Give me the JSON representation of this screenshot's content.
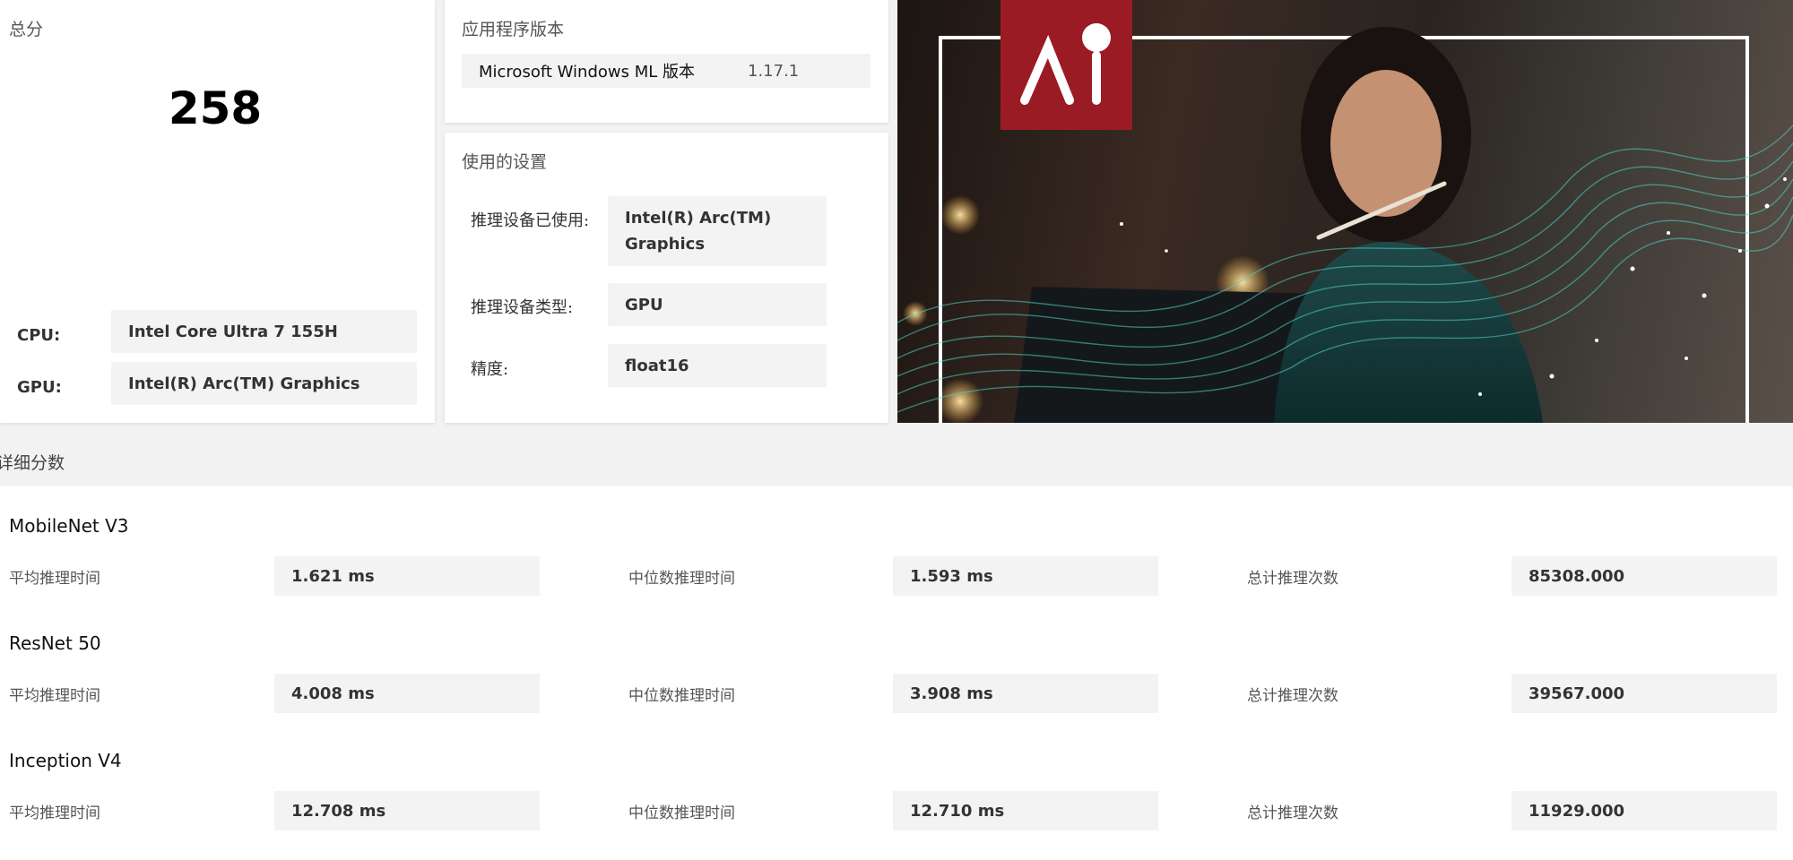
{
  "score": {
    "title": "总分",
    "value": "258",
    "cpu_label": "CPU:",
    "cpu_value": "Intel Core Ultra 7 155H",
    "gpu_label": "GPU:",
    "gpu_value": "Intel(R) Arc(TM) Graphics"
  },
  "version": {
    "title": "应用程序版本",
    "name": "Microsoft Windows ML 版本",
    "number": "1.17.1"
  },
  "settings": {
    "title": "使用的设置",
    "rows": [
      {
        "label": "推理设备已使用:",
        "value_line1": "Intel(R) Arc(TM)",
        "value_line2": "Graphics"
      },
      {
        "label": "推理设备类型:",
        "value": "GPU"
      },
      {
        "label": "精度:",
        "value": "float16"
      }
    ]
  },
  "banner": {
    "logo_text": "AI",
    "accent_color": "#9b1b24",
    "wave_color": "#4fd1c5"
  },
  "details": {
    "title": "详细分数",
    "metric_labels": [
      "平均推理时间",
      "中位数推理时间",
      "总计推理次数"
    ],
    "models": [
      {
        "name": "MobileNet V3",
        "avg": "1.621 ms",
        "median": "1.593 ms",
        "count": "85308.000"
      },
      {
        "name": "ResNet 50",
        "avg": "4.008 ms",
        "median": "3.908 ms",
        "count": "39567.000"
      },
      {
        "name": "Inception V4",
        "avg": "12.708 ms",
        "median": "12.710 ms",
        "count": "11929.000"
      }
    ]
  }
}
